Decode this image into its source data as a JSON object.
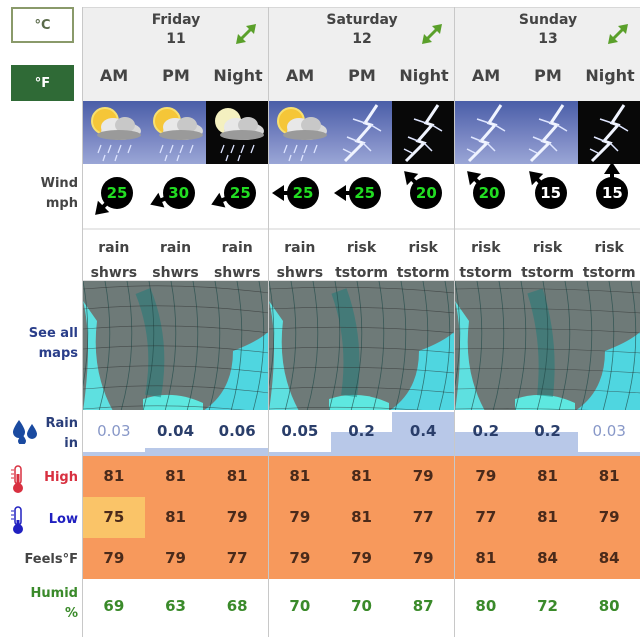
{
  "units": {
    "celsius_label": "°C",
    "fahrenheit_label": "°F",
    "selected": "°F"
  },
  "labels": {
    "wind": "Wind",
    "wind_unit": "mph",
    "maps_line1": "See all",
    "maps_line2": "maps",
    "rain": "Rain",
    "rain_unit": "in",
    "high": "High",
    "low": "Low",
    "feels": "Feels°F",
    "humid": "Humid",
    "humid_unit": "%"
  },
  "colors": {
    "temp_bg": "#f7995c",
    "temp_warm_highlight": "#fac468",
    "rain_bar": "#b8c8e8",
    "wind_strong": "#22dd22",
    "wind_light": "#ffffff",
    "humid_text": "#3a8a2a",
    "selected_unit": "#2f6a36"
  },
  "days": [
    {
      "name": "Friday",
      "date": "11",
      "periods": [
        {
          "label": "AM",
          "icon": "sun-cloud-rain-icon",
          "bg": "day",
          "wind_speed": "25",
          "wind_dir": "sw",
          "wind_color": "green",
          "condition_line1": "rain",
          "condition_line2": "shwrs",
          "rain": "0.03",
          "rain_frac": 0.0,
          "high": "81",
          "low": "75",
          "low_highlight": true,
          "feels": "79",
          "humid": "69"
        },
        {
          "label": "PM",
          "icon": "sun-cloud-rain-icon",
          "bg": "day",
          "wind_speed": "30",
          "wind_dir": "wsw",
          "wind_color": "green",
          "condition_line1": "rain",
          "condition_line2": "shwrs",
          "rain": "0.04",
          "rain_frac": 0.1,
          "high": "81",
          "low": "81",
          "low_highlight": false,
          "feels": "79",
          "humid": "63"
        },
        {
          "label": "Night",
          "icon": "moon-cloud-rain-icon",
          "bg": "night",
          "wind_speed": "25",
          "wind_dir": "wsw",
          "wind_color": "green",
          "condition_line1": "rain",
          "condition_line2": "shwrs",
          "rain": "0.06",
          "rain_frac": 0.1,
          "high": "81",
          "low": "79",
          "low_highlight": false,
          "feels": "77",
          "humid": "68"
        }
      ]
    },
    {
      "name": "Saturday",
      "date": "12",
      "periods": [
        {
          "label": "AM",
          "icon": "sun-cloud-rain-icon",
          "bg": "day",
          "wind_speed": "25",
          "wind_dir": "w",
          "wind_color": "green",
          "condition_line1": "rain",
          "condition_line2": "shwrs",
          "rain": "0.05",
          "rain_frac": 0.0,
          "high": "81",
          "low": "79",
          "low_highlight": false,
          "feels": "79",
          "humid": "70"
        },
        {
          "label": "PM",
          "icon": "lightning-icon",
          "bg": "day",
          "wind_speed": "25",
          "wind_dir": "w",
          "wind_color": "green",
          "condition_line1": "risk",
          "condition_line2": "tstorm",
          "rain": "0.2",
          "rain_frac": 0.5,
          "high": "81",
          "low": "81",
          "low_highlight": false,
          "feels": "79",
          "humid": "70"
        },
        {
          "label": "Night",
          "icon": "lightning-icon",
          "bg": "night",
          "wind_speed": "20",
          "wind_dir": "nw",
          "wind_color": "green",
          "condition_line1": "risk",
          "condition_line2": "tstorm",
          "rain": "0.4",
          "rain_frac": 1.0,
          "high": "79",
          "low": "77",
          "low_highlight": false,
          "feels": "79",
          "humid": "87"
        }
      ]
    },
    {
      "name": "Sunday",
      "date": "13",
      "periods": [
        {
          "label": "AM",
          "icon": "lightning-icon",
          "bg": "day",
          "wind_speed": "20",
          "wind_dir": "nw",
          "wind_color": "green",
          "condition_line1": "risk",
          "condition_line2": "tstorm",
          "rain": "0.2",
          "rain_frac": 0.5,
          "high": "79",
          "low": "77",
          "low_highlight": false,
          "feels": "81",
          "humid": "80"
        },
        {
          "label": "PM",
          "icon": "lightning-icon",
          "bg": "day",
          "wind_speed": "15",
          "wind_dir": "nw",
          "wind_color": "white",
          "condition_line1": "risk",
          "condition_line2": "tstorm",
          "rain": "0.2",
          "rain_frac": 0.5,
          "high": "81",
          "low": "81",
          "low_highlight": false,
          "feels": "84",
          "humid": "72"
        },
        {
          "label": "Night",
          "icon": "lightning-icon",
          "bg": "night",
          "wind_speed": "15",
          "wind_dir": "n",
          "wind_color": "white",
          "condition_line1": "risk",
          "condition_line2": "tstorm",
          "rain": "0.03",
          "rain_frac": 0.0,
          "high": "81",
          "low": "79",
          "low_highlight": false,
          "feels": "84",
          "humid": "80"
        }
      ]
    }
  ]
}
